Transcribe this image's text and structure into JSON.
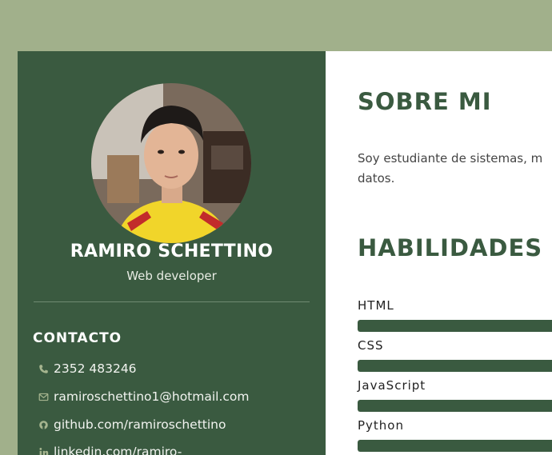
{
  "profile": {
    "name": "RAMIRO SCHETTINO",
    "role": "Web developer"
  },
  "contact": {
    "title": "CONTACTO",
    "items": [
      {
        "icon": "phone-icon",
        "text": "2352 483246"
      },
      {
        "icon": "mail-icon",
        "text": "ramiroschettino1@hotmail.com"
      },
      {
        "icon": "github-icon",
        "text": "github.com/ramiroschettino"
      },
      {
        "icon": "linkedin-icon",
        "text": "linkedin.com/ramiro-"
      }
    ]
  },
  "about": {
    "title": "SOBRE MI",
    "line1": "Soy estudiante de sistemas, m",
    "line2": "datos."
  },
  "skills": {
    "title": "HABILIDADES",
    "items": [
      {
        "label": "HTML",
        "level": 1.0
      },
      {
        "label": "CSS",
        "level": 1.0
      },
      {
        "label": "JavaScript",
        "level": 1.0
      },
      {
        "label": "Python",
        "level": 1.0
      }
    ]
  },
  "colors": {
    "sidebar": "#3a5a40",
    "background": "#a1b08b",
    "accent": "#3a5a40"
  }
}
